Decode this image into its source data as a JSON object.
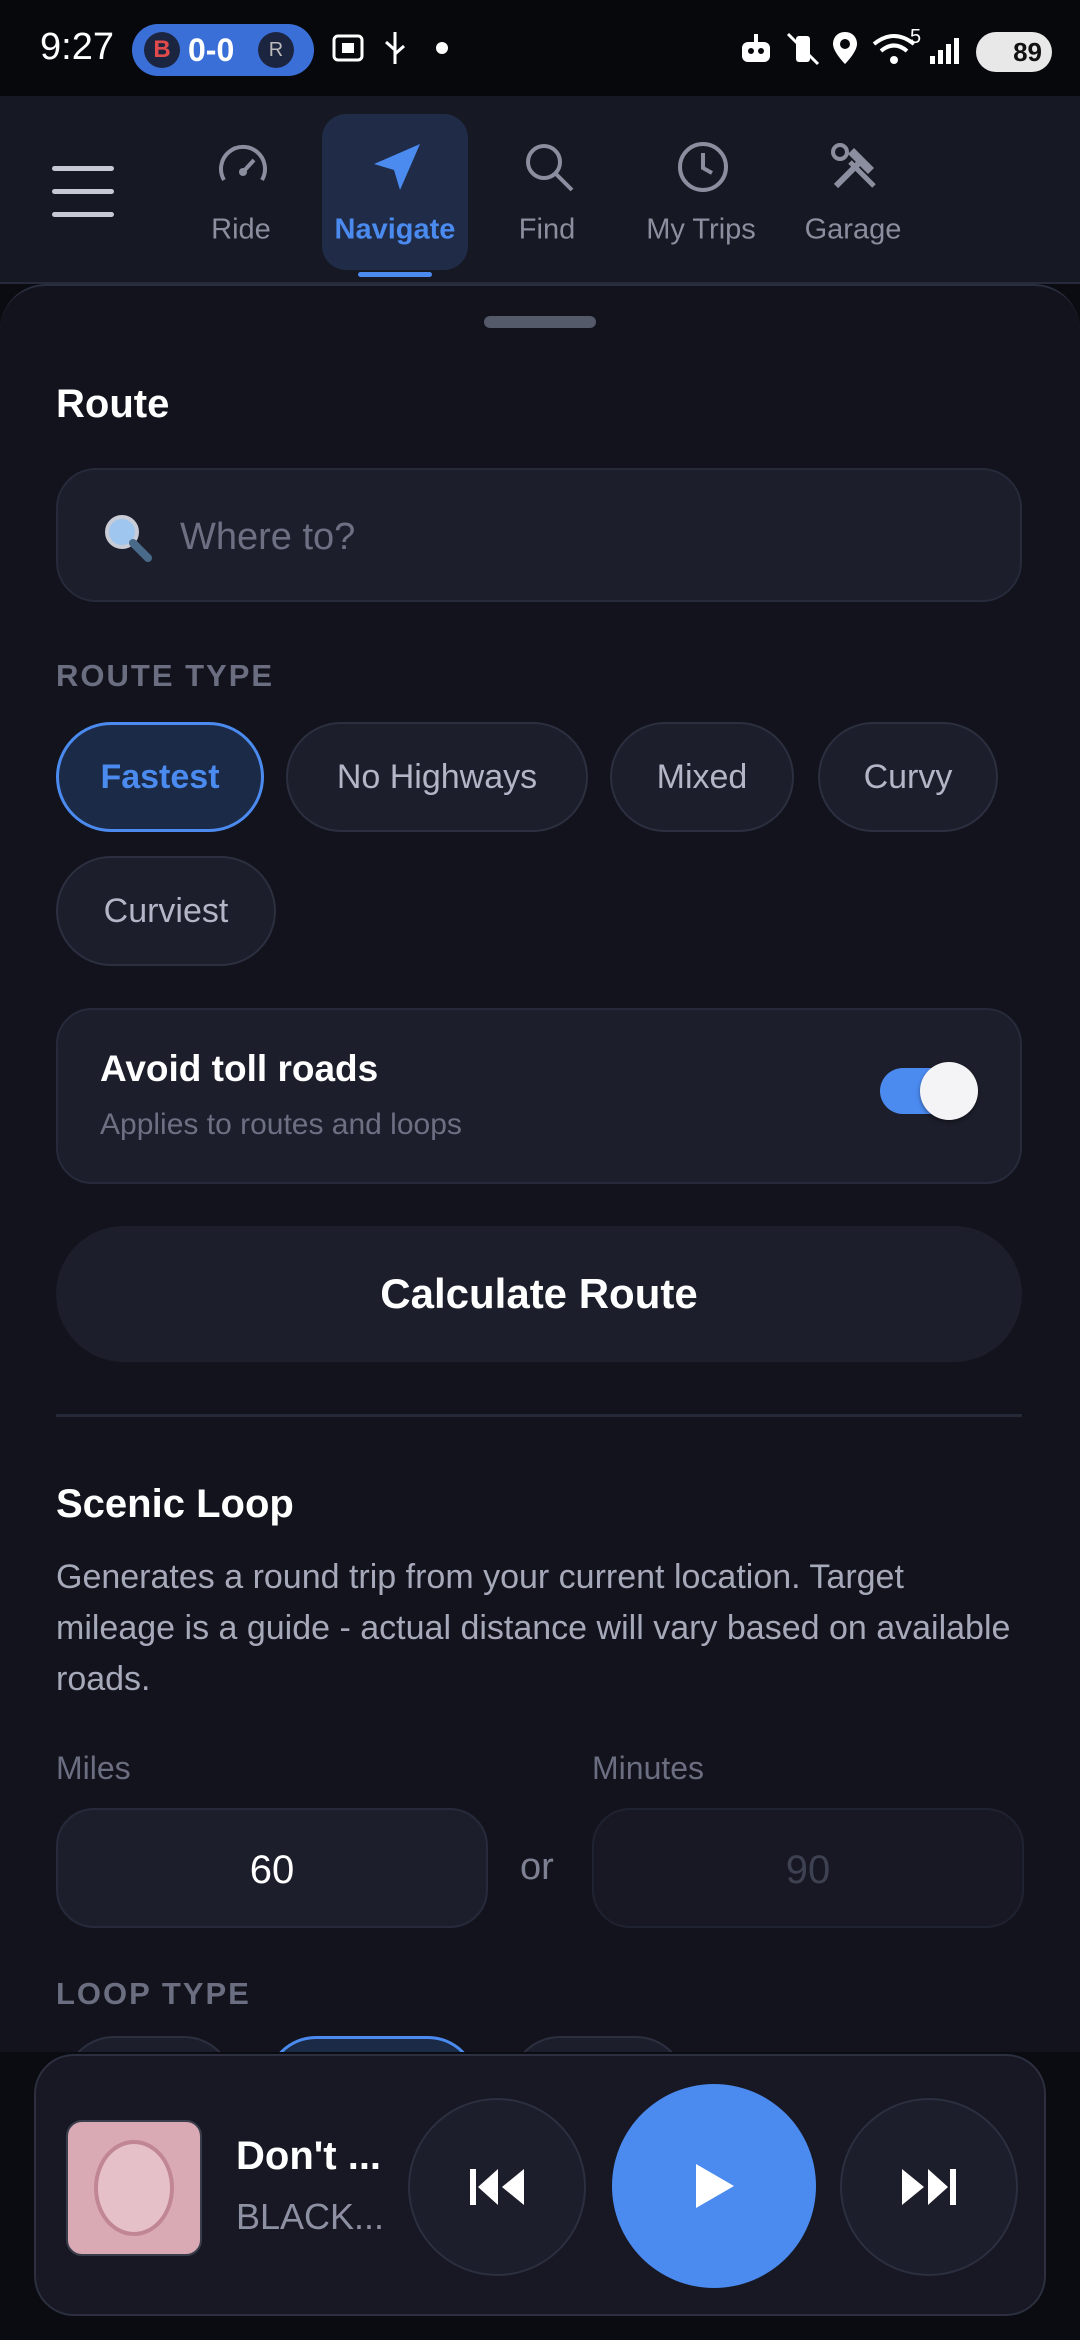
{
  "status_bar": {
    "time": "9:27",
    "score": "0-0",
    "left_team_logo": "B",
    "right_team_logo": "R",
    "wifi_label": "5",
    "battery": "89"
  },
  "nav": {
    "tabs": [
      {
        "label": "Ride",
        "icon": "speedometer-icon"
      },
      {
        "label": "Navigate",
        "icon": "navigation-arrow-icon",
        "active": true
      },
      {
        "label": "Find",
        "icon": "search-icon"
      },
      {
        "label": "My Trips",
        "icon": "clock-icon"
      },
      {
        "label": "Garage",
        "icon": "tools-icon"
      }
    ]
  },
  "route": {
    "title": "Route",
    "search_placeholder": "Where to?",
    "route_type_label": "ROUTE TYPE",
    "route_types": [
      "Fastest",
      "No Highways",
      "Mixed",
      "Curvy",
      "Curviest"
    ],
    "selected_route_type": "Fastest",
    "avoid_tolls": {
      "title": "Avoid toll roads",
      "subtitle": "Applies to routes and loops",
      "enabled": true
    },
    "calculate_label": "Calculate Route"
  },
  "scenic_loop": {
    "title": "Scenic Loop",
    "description": "Generates a round trip from your current location. Target mileage is a guide - actual distance will vary based on available roads.",
    "miles_label": "Miles",
    "miles_value": "60",
    "or_label": "or",
    "minutes_label": "Minutes",
    "minutes_placeholder": "90",
    "loop_type_label": "LOOP TYPE"
  },
  "player": {
    "song": "Don't ...",
    "artist": "BLACK...",
    "accent_color": "#4b8bf0"
  }
}
